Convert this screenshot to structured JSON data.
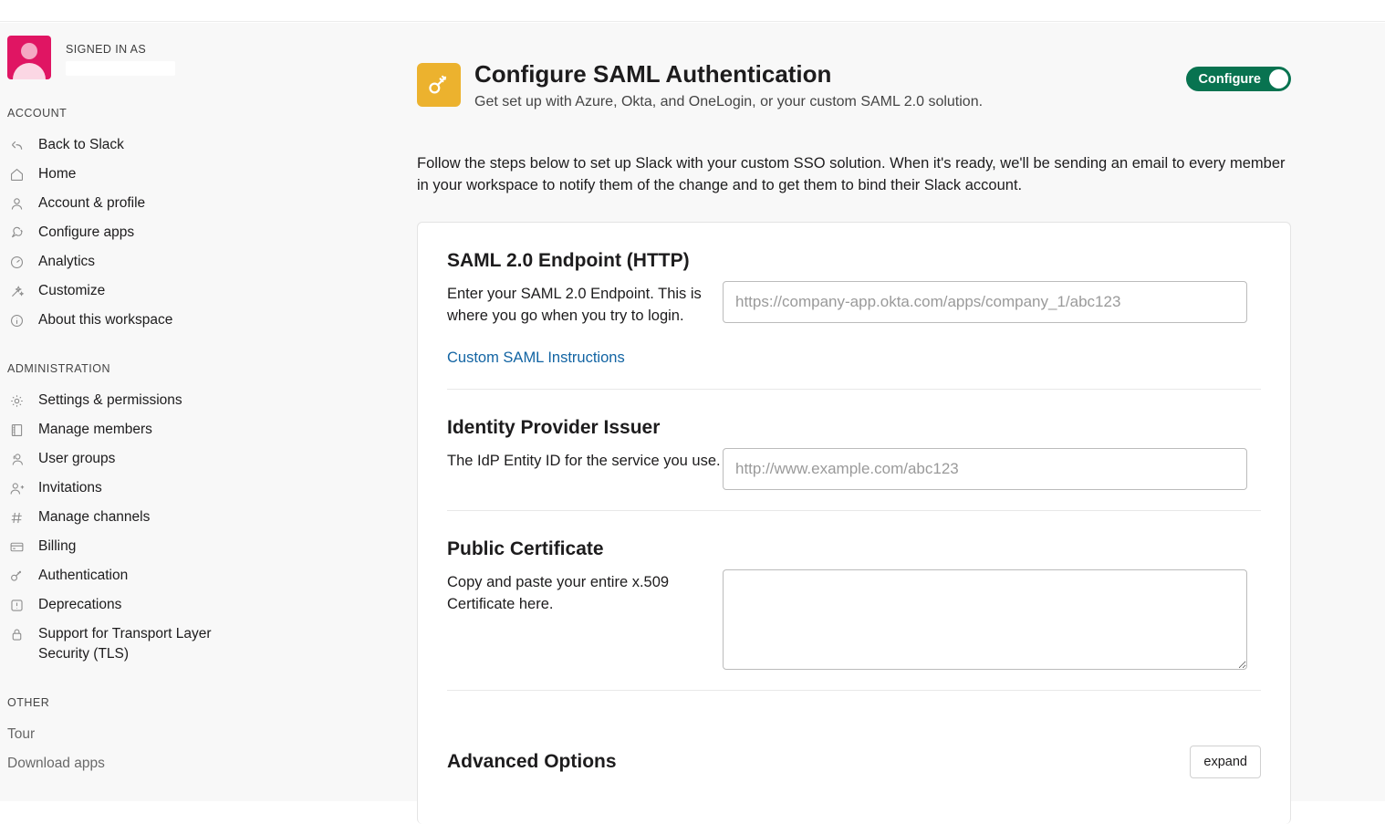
{
  "sidebar": {
    "signed_in_label": "SIGNED IN AS",
    "signed_in_name": "",
    "sections": [
      {
        "title": "ACCOUNT",
        "items": [
          {
            "label": "Back to Slack",
            "icon": "back-arrow-icon"
          },
          {
            "label": "Home",
            "icon": "home-icon"
          },
          {
            "label": "Account & profile",
            "icon": "person-icon"
          },
          {
            "label": "Configure apps",
            "icon": "plug-icon"
          },
          {
            "label": "Analytics",
            "icon": "gauge-icon"
          },
          {
            "label": "Customize",
            "icon": "wand-icon"
          },
          {
            "label": "About this workspace",
            "icon": "info-icon"
          }
        ]
      },
      {
        "title": "ADMINISTRATION",
        "items": [
          {
            "label": "Settings & permissions",
            "icon": "gear-icon"
          },
          {
            "label": "Manage members",
            "icon": "book-icon"
          },
          {
            "label": "User groups",
            "icon": "people-icon"
          },
          {
            "label": "Invitations",
            "icon": "person-add-icon"
          },
          {
            "label": "Manage channels",
            "icon": "hash-icon"
          },
          {
            "label": "Billing",
            "icon": "credit-card-icon"
          },
          {
            "label": "Authentication",
            "icon": "key-icon"
          },
          {
            "label": "Deprecations",
            "icon": "alert-icon"
          },
          {
            "label": "Support for Transport Layer Security (TLS)",
            "icon": "lock-icon"
          }
        ]
      },
      {
        "title": "OTHER",
        "items": [
          {
            "label": "Tour",
            "icon": ""
          },
          {
            "label": "Download apps",
            "icon": ""
          }
        ]
      }
    ]
  },
  "header": {
    "icon": "key-icon",
    "title": "Configure SAML Authentication",
    "subtitle": "Get set up with Azure, Okta, and OneLogin, or your custom SAML 2.0 solution.",
    "toggle_label": "Configure",
    "toggle_state": "on"
  },
  "intro": "Follow the steps below to set up Slack with your custom SSO solution. When it's ready, we'll be sending an email to every member in your workspace to notify them of the change and to get them to bind their Slack account.",
  "form": {
    "endpoint": {
      "title": "SAML 2.0 Endpoint (HTTP)",
      "description": "Enter your SAML 2.0 Endpoint. This is where you go when you try to login.",
      "link": "Custom SAML Instructions",
      "value": "",
      "placeholder": "https://company-app.okta.com/apps/company_1/abc123"
    },
    "issuer": {
      "title": "Identity Provider Issuer",
      "description": "The IdP Entity ID for the service you use.",
      "value": "",
      "placeholder": "http://www.example.com/abc123"
    },
    "certificate": {
      "title": "Public Certificate",
      "description": "Copy and paste your entire x.509 Certificate here.",
      "value": "",
      "placeholder": ""
    },
    "advanced": {
      "title": "Advanced Options",
      "expand_label": "expand"
    }
  },
  "colors": {
    "accent_green": "#087350",
    "header_icon_bg": "#ecb22e",
    "avatar_bg": "#e01563",
    "link_blue": "#1264a3",
    "page_bg": "#f8f8f8"
  }
}
